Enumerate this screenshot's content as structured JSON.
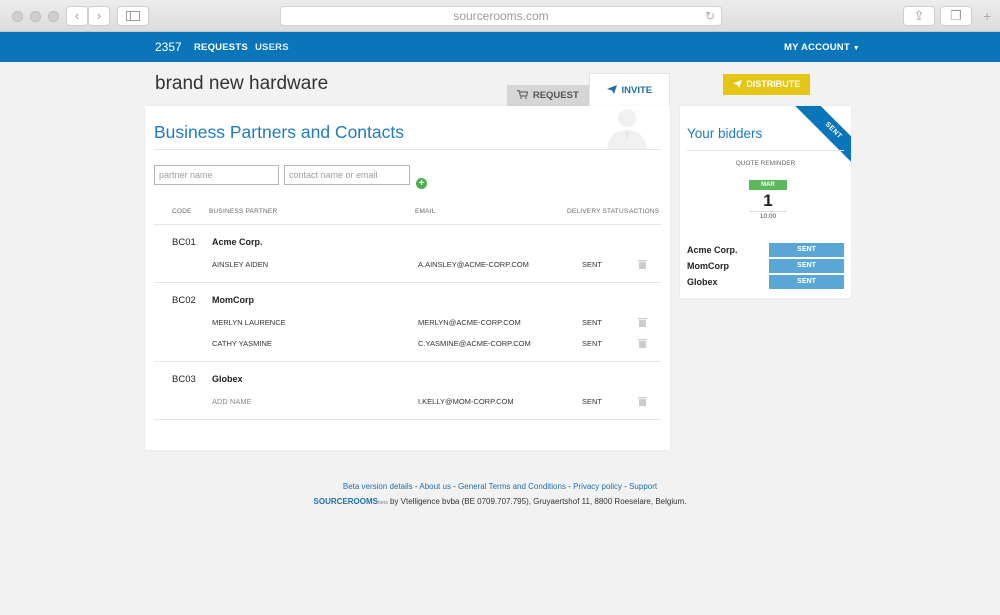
{
  "browser": {
    "url": "sourcerooms.com"
  },
  "nav": {
    "project_number": "2357",
    "requests": "REQUESTS",
    "users": "USERS",
    "my_account": "MY ACCOUNT"
  },
  "header": {
    "title": "brand new hardware",
    "tab_request": "REQUEST",
    "tab_invite": "INVITE",
    "distribute": "DISTRIBUTE"
  },
  "partners": {
    "title": "Business Partners and Contacts",
    "partner_placeholder": "partner name",
    "contact_placeholder": "contact name or email",
    "columns": {
      "code": "CODE",
      "partner": "BUSINESS PARTNER",
      "email": "EMAIL",
      "status": "DELIVERY STATUS",
      "actions": "ACTIONS"
    },
    "groups": [
      {
        "code": "BC01",
        "name": "Acme Corp.",
        "contacts": [
          {
            "name": "AINSLEY AIDEN",
            "email": "A.AINSLEY@ACME-CORP.COM",
            "status": "SENT"
          }
        ]
      },
      {
        "code": "BC02",
        "name": "MomCorp",
        "contacts": [
          {
            "name": "MERLYN LAURENCE",
            "email": "MERLYN@ACME-CORP.COM",
            "status": "SENT"
          },
          {
            "name": "CATHY YASMINE",
            "email": "C.YASMINE@ACME-CORP.COM",
            "status": "SENT"
          }
        ]
      },
      {
        "code": "BC03",
        "name": "Globex",
        "contacts": [
          {
            "name": "ADD NAME",
            "email": "I.KELLY@MOM-CORP.COM",
            "status": "SENT"
          }
        ]
      }
    ]
  },
  "bidders": {
    "title": "Your bidders",
    "ribbon": "SENT",
    "reminder_label": "QUOTE REMINDER",
    "reminder_month": "MAR",
    "reminder_day": "1",
    "reminder_time": "10:00",
    "list": [
      {
        "name": "Acme Corp.",
        "status": "SENT"
      },
      {
        "name": "MomCorp",
        "status": "SENT"
      },
      {
        "name": "Globex",
        "status": "SENT"
      }
    ]
  },
  "footer": {
    "links": [
      "Beta version details",
      "About us",
      "General Terms and Conditions",
      "Privacy policy",
      "Support"
    ],
    "brand": "SOURCEROOMS",
    "brand_beta": "beta",
    "company": "by Vtelligence bvba (BE 0709.707.795), Gruyaertshof 11, 8800 Roeselare, Belgium."
  },
  "icons": [
    "back-icon",
    "forward-icon",
    "sidebar-icon",
    "reload-icon",
    "share-icon",
    "tabs-icon",
    "new-tab-icon",
    "cart-icon",
    "send-icon",
    "add-icon",
    "trash-icon",
    "contact-silhouette-icon",
    "caret-down-icon"
  ]
}
